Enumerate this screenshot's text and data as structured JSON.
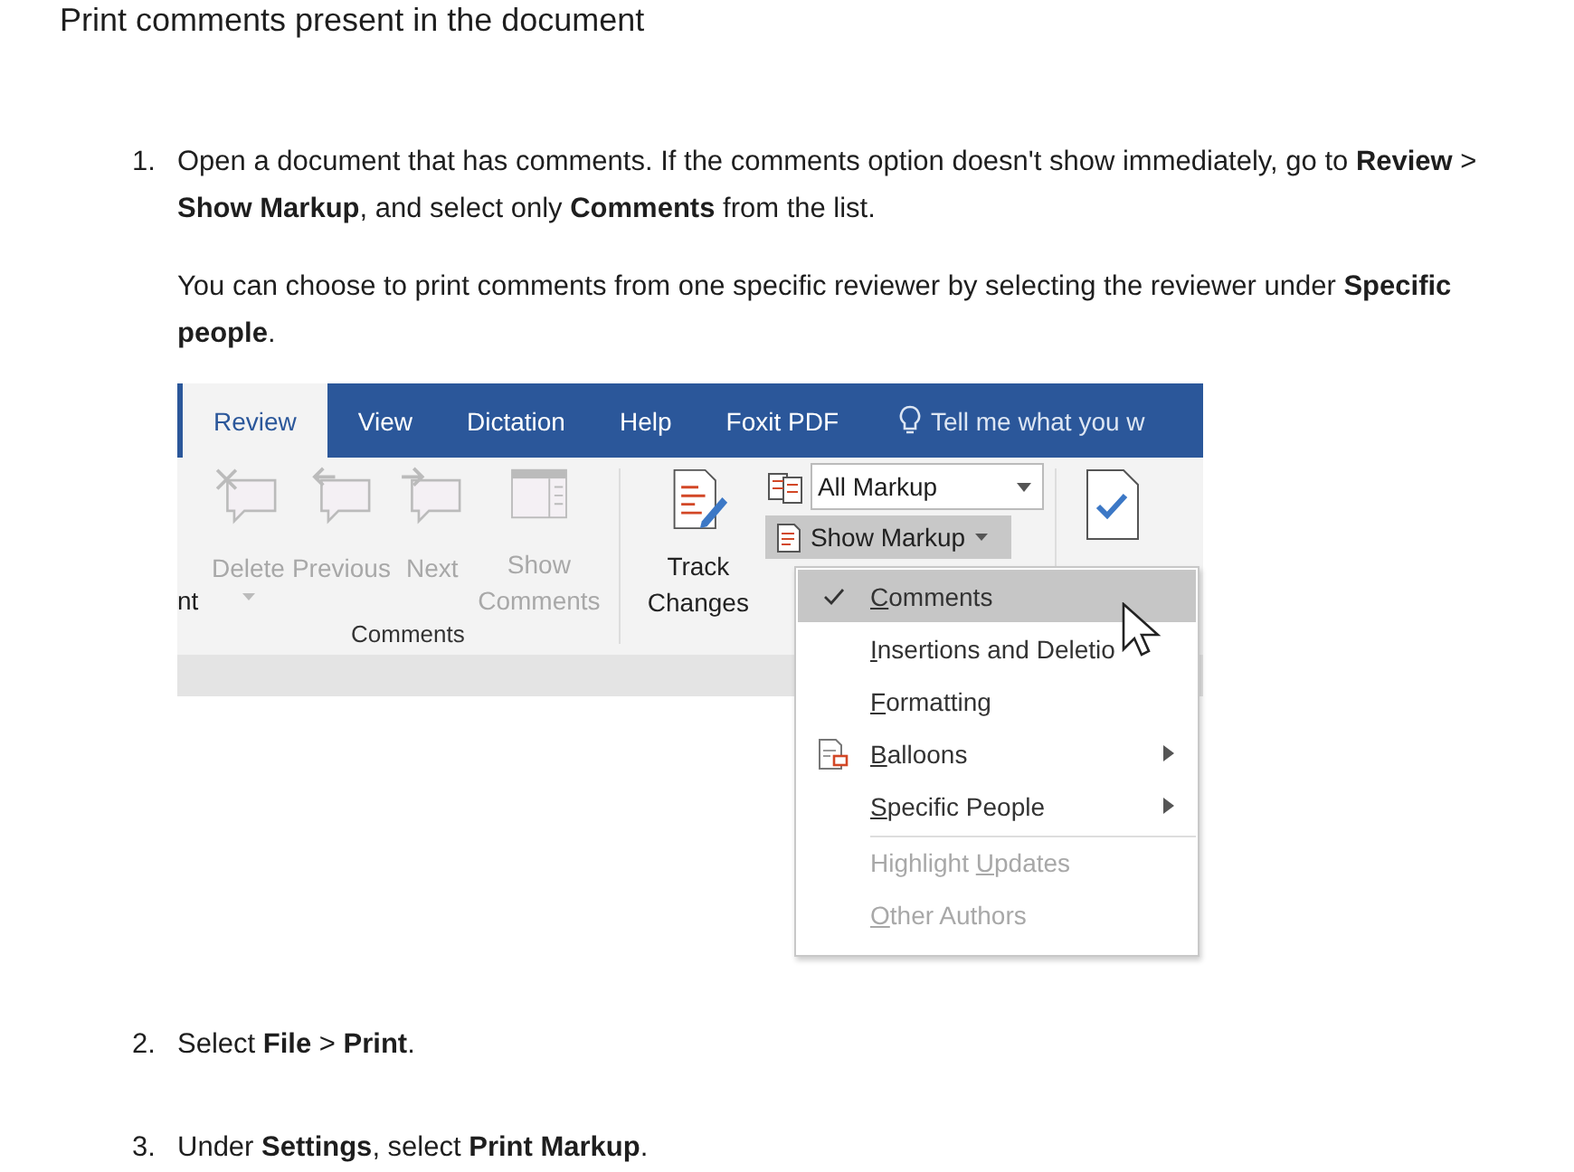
{
  "heading": "Print comments present in the document",
  "steps": [
    {
      "number": "1.",
      "paragraphs": [
        "Open a document that has comments. If the comments option doesn't show immediately, go to **Review** > **Show Markup**, and select only **Comments** from the list.",
        "You can choose to print comments from one specific reviewer by selecting the reviewer under **Specific people**."
      ],
      "figure": {
        "tabs": [
          {
            "label": "Review",
            "selected": true
          },
          {
            "label": "View",
            "selected": false
          },
          {
            "label": "Dictation",
            "selected": false
          },
          {
            "label": "Help",
            "selected": false
          },
          {
            "label": "Foxit PDF",
            "selected": false
          }
        ],
        "tell_me": "Tell me what you w",
        "cut_label": "nt",
        "comment_buttons": [
          {
            "kind": "delete",
            "label": "Delete",
            "disabled": true,
            "dropdown": true
          },
          {
            "kind": "previous",
            "label": "Previous",
            "disabled": true,
            "dropdown": false
          },
          {
            "kind": "next",
            "label": "Next",
            "disabled": true,
            "dropdown": false
          },
          {
            "kind": "show",
            "label": "Show Comments",
            "disabled": true,
            "dropdown": false
          }
        ],
        "group_label": "Comments",
        "track_changes": "Track Changes",
        "markup_select": "All Markup",
        "show_markup": {
          "label": "Show Markup",
          "expanded": true
        },
        "menu": [
          {
            "key": "C",
            "after": "omments",
            "checked": true,
            "selected": true,
            "disabled": false,
            "submenu": false,
            "icon": false,
            "separator_before": false
          },
          {
            "key": "I",
            "after": "nsertions and Deletio",
            "checked": false,
            "selected": false,
            "disabled": false,
            "submenu": false,
            "icon": false,
            "separator_before": false
          },
          {
            "key": "F",
            "after": "ormatting",
            "checked": false,
            "selected": false,
            "disabled": false,
            "submenu": false,
            "icon": false,
            "separator_before": false
          },
          {
            "key": "B",
            "after": "alloons",
            "checked": false,
            "selected": false,
            "disabled": false,
            "submenu": true,
            "icon": true,
            "separator_before": false
          },
          {
            "key": "S",
            "after": "pecific People",
            "checked": false,
            "selected": false,
            "disabled": false,
            "submenu": true,
            "icon": false,
            "separator_before": false
          },
          {
            "before": "Highlight ",
            "key": "U",
            "after": "pdates",
            "checked": false,
            "selected": false,
            "disabled": true,
            "submenu": false,
            "icon": false,
            "separator_before": true
          },
          {
            "key": "O",
            "after": "ther Authors",
            "checked": false,
            "selected": false,
            "disabled": true,
            "submenu": false,
            "icon": false,
            "separator_before": false
          }
        ]
      }
    },
    {
      "number": "2.",
      "paragraphs": [
        "Select **File** > **Print**."
      ]
    },
    {
      "number": "3.",
      "paragraphs": [
        "Under **Settings**, select **Print Markup**."
      ]
    }
  ]
}
